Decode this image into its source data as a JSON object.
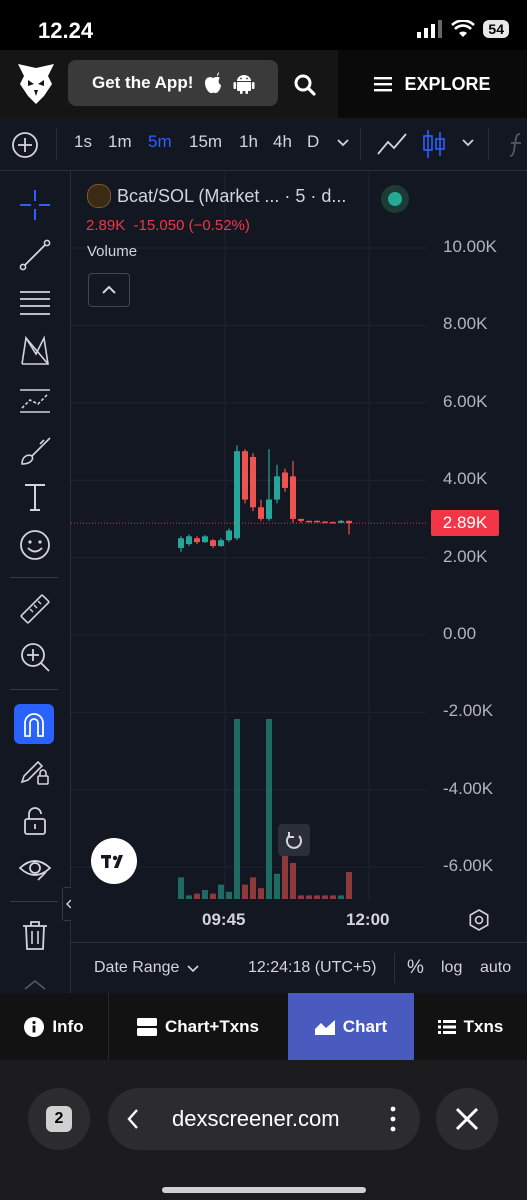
{
  "status": {
    "time": "12.24",
    "battery": "54"
  },
  "nav": {
    "get_app": "Get the App!",
    "explore": "EXPLORE"
  },
  "toolbar": {
    "intervals": [
      "1s",
      "1m",
      "5m",
      "15m",
      "1h",
      "4h",
      "D"
    ],
    "active_interval": "5m"
  },
  "legend": {
    "symbol": "Bcat/SOL (Market ... · 5 · d...",
    "price": "2.89K",
    "change": "-15.050 (−0.52%)",
    "volume_label": "Volume"
  },
  "price_axis": {
    "labels": [
      "10.00K",
      "8.00K",
      "6.00K",
      "4.00K",
      "2.00K",
      "0.00",
      "-2.00K",
      "-4.00K",
      "-6.00K"
    ],
    "current_price": "2.89K"
  },
  "time_axis": {
    "labels": [
      "09:45",
      "12:00"
    ]
  },
  "chart_data": {
    "type": "candlestick",
    "ylim": [
      -6500,
      10500
    ],
    "current_price": 2890,
    "candles": [
      {
        "o": 2250,
        "c": 2500,
        "h": 2550,
        "l": 2150,
        "dir": "up"
      },
      {
        "o": 2350,
        "c": 2550,
        "h": 2600,
        "l": 2300,
        "dir": "up"
      },
      {
        "o": 2500,
        "c": 2400,
        "h": 2550,
        "l": 2350,
        "dir": "down"
      },
      {
        "o": 2400,
        "c": 2550,
        "h": 2580,
        "l": 2380,
        "dir": "up"
      },
      {
        "o": 2450,
        "c": 2300,
        "h": 2480,
        "l": 2250,
        "dir": "down"
      },
      {
        "o": 2300,
        "c": 2450,
        "h": 2500,
        "l": 2280,
        "dir": "up"
      },
      {
        "o": 2450,
        "c": 2700,
        "h": 2750,
        "l": 2400,
        "dir": "up"
      },
      {
        "o": 2500,
        "c": 4750,
        "h": 4900,
        "l": 2450,
        "dir": "up"
      },
      {
        "o": 4750,
        "c": 3500,
        "h": 4800,
        "l": 3400,
        "dir": "down"
      },
      {
        "o": 4600,
        "c": 3300,
        "h": 4700,
        "l": 3200,
        "dir": "down"
      },
      {
        "o": 3300,
        "c": 3000,
        "h": 3500,
        "l": 2950,
        "dir": "down"
      },
      {
        "o": 3000,
        "c": 3500,
        "h": 4800,
        "l": 2950,
        "dir": "up"
      },
      {
        "o": 3500,
        "c": 4100,
        "h": 4400,
        "l": 3400,
        "dir": "up"
      },
      {
        "o": 4200,
        "c": 3800,
        "h": 4300,
        "l": 3700,
        "dir": "down"
      },
      {
        "o": 4100,
        "c": 3000,
        "h": 4500,
        "l": 2900,
        "dir": "down"
      },
      {
        "o": 3000,
        "c": 2950,
        "h": 3000,
        "l": 2900,
        "dir": "down"
      },
      {
        "o": 2950,
        "c": 2950,
        "h": 2960,
        "l": 2930,
        "dir": "down"
      },
      {
        "o": 2950,
        "c": 2930,
        "h": 2960,
        "l": 2920,
        "dir": "down"
      },
      {
        "o": 2930,
        "c": 2920,
        "h": 2940,
        "l": 2900,
        "dir": "down"
      },
      {
        "o": 2920,
        "c": 2910,
        "h": 2930,
        "l": 2900,
        "dir": "down"
      },
      {
        "o": 2900,
        "c": 2950,
        "h": 2970,
        "l": 2890,
        "dir": "up"
      },
      {
        "o": 2950,
        "c": 2890,
        "h": 2960,
        "l": 2600,
        "dir": "down"
      }
    ],
    "volume": [
      0.12,
      0.02,
      0.03,
      0.05,
      0.03,
      0.08,
      0.04,
      1.0,
      0.08,
      0.12,
      0.06,
      1.0,
      0.14,
      0.38,
      0.2,
      0.02,
      0.02,
      0.02,
      0.02,
      0.02,
      0.02,
      0.15
    ]
  },
  "bottom": {
    "date_range": "Date Range",
    "time": "12:24:18 (UTC+5)",
    "percent": "%",
    "log": "log",
    "auto": "auto"
  },
  "tabs": {
    "info": "Info",
    "chart_txns": "Chart+Txns",
    "chart": "Chart",
    "txns": "Txns"
  },
  "browser": {
    "tab_count": "2",
    "url": "dexscreener.com"
  },
  "colors": {
    "up": "#26a69a",
    "down": "#ef5350",
    "accent": "#2962ff",
    "active_tab": "#4a5bbf"
  }
}
